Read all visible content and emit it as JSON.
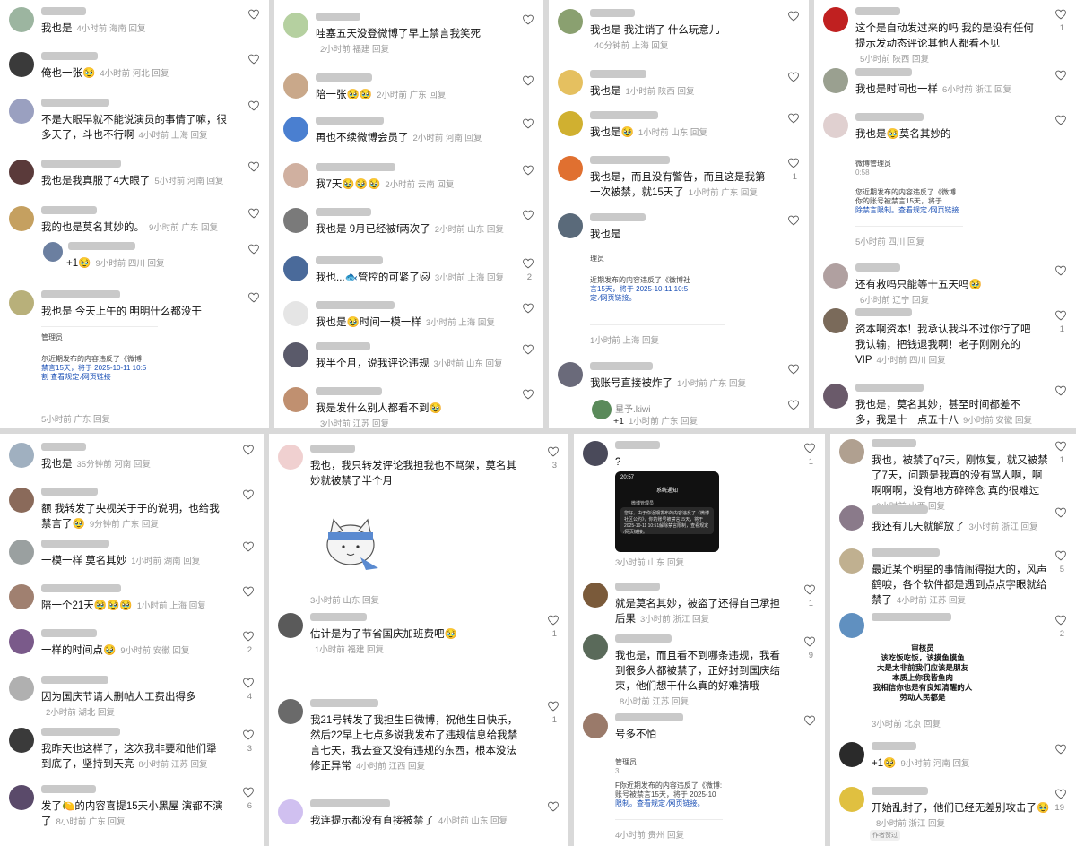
{
  "p1": [
    {
      "text": "我也是",
      "meta": "4小时前 海南 回复",
      "av": "#9cb5a0"
    },
    {
      "text": "俺也一张🥹",
      "meta": "4小时前 河北 回复",
      "av": "#3a3a3a"
    },
    {
      "text": "不是大眼早就不能说演员的事情了嘛，很多天了，斗也不行啊",
      "meta": "4小时前 上海 回复",
      "av": "#9aa0c0"
    },
    {
      "text": "我也是我真服了4大眼了",
      "meta": "5小时前 河南 回复",
      "av": "#5a3a3a"
    },
    {
      "text": "我的也是莫名其妙的。",
      "meta": "9小时前 广东 回复",
      "av": "#c5a060"
    },
    {
      "text": "+1🥹",
      "meta": "9小时前 四川 回复",
      "av": "#6b7fa0",
      "reply": true
    },
    {
      "text": "我也是 今天上午的 明明什么都没干",
      "meta": "",
      "av": "#b8b07a"
    }
  ],
  "p1_card": [
    "管理员",
    "",
    "尔近期发布的内容违反了《微博",
    "禁言15天，将于 2025-10-11 10:5",
    "割 查看规定 ⁄网页链接"
  ],
  "p1_card_meta": "5小时前 广东 回复",
  "p2": [
    {
      "text": "哇塞五天没登微博了早上禁言我笑死",
      "meta": "2小时前 福建 回复",
      "av": "#b5d0a0"
    },
    {
      "text": "陪一张🥹🥹",
      "meta": "2小时前 广东 回复",
      "av": "#c9a88a"
    },
    {
      "text": "再也不续微博会员了",
      "meta": "2小时前 河南 回复",
      "av": "#4a7fd0"
    },
    {
      "text": "我7天🥹🥹🥹",
      "meta": "2小时前 云南 回复",
      "av": "#d0b0a0"
    },
    {
      "text": "我也是 9月已经被f两次了",
      "meta": "2小时前 山东 回复",
      "av": "#7a7a7a"
    },
    {
      "text": "我也...🐟管控的可紧了🐱",
      "meta": "3小时前 上海 回复",
      "av": "#4a6a9a",
      "cnt": "2"
    },
    {
      "text": "我也是🥹时间一模一样",
      "meta": "3小时前 上海 回复",
      "av": "#e5e5e5"
    },
    {
      "text": "我半个月，说我评论违规",
      "meta": "3小时前 山东 回复",
      "av": "#5a5a6a"
    },
    {
      "text": "我是发什么别人都看不到🥹",
      "meta": "3小时前 江苏 回复",
      "av": "#c09070"
    }
  ],
  "p3": [
    {
      "text": "我也是 我注销了 什么玩意儿",
      "meta": "40分钟前 上海 回复",
      "av": "#8aa070"
    },
    {
      "text": "我也是",
      "meta": "1小时前 陕西 回复",
      "av": "#e5c060"
    },
    {
      "text": "我也是🥹",
      "meta": "1小时前 山东 回复",
      "av": "#d0b030"
    },
    {
      "text": "我也是，而且没有警告，而且这是我第一次被禁，就15天了",
      "meta": "1小时前 广东 回复",
      "av": "#e07030",
      "cnt": "1"
    },
    {
      "text": "我也是",
      "meta": "",
      "av": "#5a6a7a"
    }
  ],
  "p3_card": [
    "理员",
    "",
    "近期发布的内容违反了《微博社",
    "言15天，将于 2025-10-11 10:5",
    "定 ⁄网页链接。"
  ],
  "p3_card_meta": "1小时前 上海 回复",
  "p3_last": {
    "text": "我账号直接被炸了",
    "meta": "1小时前 广东 回复",
    "av": "#6a6a7a"
  },
  "p3_reply": {
    "name": "星予.kiwi",
    "text": "+1",
    "meta": "1小时前 广东 回复"
  },
  "p4": [
    {
      "text": "这个是自动发过来的吗 我的是没有任何提示发动态评论其他人都看不见",
      "meta": "5小时前 陕西 回复",
      "av": "#c02020",
      "cnt": "1"
    },
    {
      "text": "我也是时间也一样",
      "meta": "6小时前 浙江 回复",
      "av": "#9aa090"
    },
    {
      "text": "我也是🥹莫名其妙的",
      "meta": "",
      "av": "#e0d0d0"
    }
  ],
  "p4_card": [
    "微博管理员",
    "0:58",
    "",
    "您近期发布的内容违反了《微博",
    "你的账号被禁言15天，将于",
    "除禁言限制。查看规定 ⁄网页链接"
  ],
  "p4_card_meta": "5小时前 四川 回复",
  "p4b": [
    {
      "text": "还有救吗只能等十五天吗🥹",
      "meta": "6小时前 辽宁 回复",
      "av": "#b0a0a0"
    },
    {
      "text": "资本啊资本！我承认我斗不过你行了吧我认输，把钱退我啊！老子刚刚充的VIP",
      "meta": "4小时前 四川 回复",
      "av": "#7a6a5a",
      "cnt": "1"
    },
    {
      "text": "我也是，莫名其妙，甚至时间都差不多，我是十一点五十八",
      "meta": "9小时前 安徽 回复",
      "av": "#6a5a6a"
    }
  ],
  "p5": [
    {
      "text": "我也是",
      "meta": "35分钟前 河南 回复",
      "av": "#a0b0c0"
    },
    {
      "text": "额 我转发了央视关于于的说明，也给我禁言了🥹",
      "meta": "9分钟前 广东 回复",
      "av": "#8a6a5a"
    },
    {
      "text": "一模一样 莫名其妙",
      "meta": "1小时前 湖南 回复",
      "av": "#9aa0a0"
    },
    {
      "text": "陪一个21天🥹🥹🥹",
      "meta": "1小时前 上海 回复",
      "av": "#a08070"
    },
    {
      "text": "一样的时间点🥹",
      "meta": "9小时前 安徽 回复",
      "av": "#7a5a8a",
      "cnt": "2"
    },
    {
      "text": "因为国庆节请人删帖人工费出得多",
      "meta": "2小时前 湖北 回复",
      "av": "#b0b0b0",
      "cnt": "4"
    },
    {
      "text": "我昨天也这样了，这次我非要和他们犟到底了，坚持到天亮",
      "meta": "8小时前 江苏 回复",
      "av": "#3a3a3a",
      "cnt": "3"
    },
    {
      "text": "发了🍋的内容喜提15天小黑屋 演都不演了",
      "meta": "8小时前 广东 回复",
      "av": "#5a4a6a",
      "cnt": "6"
    }
  ],
  "p6": [
    {
      "text": "我也，我只转发评论我担我也不骂架，莫名其妙就被禁了半个月",
      "meta": "3小时前 山东 回复",
      "av": "#f0d0d0",
      "cnt": "3"
    },
    {
      "text": "估计是为了节省国庆加班费吧🥹",
      "meta": "1小时前 福建 回复",
      "av": "#5a5a5a",
      "cnt": "1"
    },
    {
      "text": "我21号转发了我担生日微博，祝他生日快乐，然后22早上七点多说我发布了违规信息给我禁言七天，我去查又没有违规的东西，根本没法修正异常",
      "meta": "4小时前 江西 回复",
      "av": "#6a6a6a",
      "cnt": "1"
    },
    {
      "text": "我连提示都没有直接被禁了",
      "meta": "4小时前 山东 回复",
      "av": "#d0c0f0"
    }
  ],
  "p7": [
    {
      "text": "?",
      "meta": "",
      "av": "#4a4a5a",
      "cnt": "1"
    }
  ],
  "p7_phone": {
    "time": "20:57",
    "title": "系统通知",
    "sender": "微博管理员",
    "body": "您好，由于你近期发布的内容违反了《微博社区公约》，你的账号被禁言15天，将于 2025-10-11 10:51解除禁言限制，查看规定 ⁄网页链接。"
  },
  "p7_phone_meta": "3小时前 山东 回复",
  "p7b": [
    {
      "text": "就是莫名其妙，被盗了还得自己承担后果",
      "meta": "3小时前 浙江 回复",
      "av": "#7a5a3a",
      "cnt": "1"
    },
    {
      "text": "我也是，而且看不到哪条违规，我看到很多人都被禁了，正好封到国庆结束，他们想干什么真的好难猜哦",
      "meta": "8小时前 江苏 回复",
      "av": "#5a6a5a",
      "cnt": "9"
    },
    {
      "text": "号多不怕",
      "meta": "",
      "av": "#9a7a6a"
    }
  ],
  "p7_card": [
    "管理员",
    "3",
    "",
    "F你近期发布的内容违反了《微博:",
    "账号被禁言15天，将于 2025-10",
    "限制。查看规定 ⁄网页链接。"
  ],
  "p7_card_meta": "4小时前 贵州 回复",
  "p8": [
    {
      "text": "我也，被禁了q7天，刚恢复，就又被禁了7天，问题是我真的没有骂人啊，啊啊啊啊，没有地方碎碎念 真的很难过",
      "meta": "3小时前 山西 回复",
      "av": "#b0a090",
      "cnt": "1"
    },
    {
      "text": "我还有几天就解放了",
      "meta": "3小时前 浙江 回复",
      "av": "#8a7a8a"
    },
    {
      "text": "最近某个明星的事情闹得挺大的，风声鹤唳，各个软件都是遇到点点字眼就给禁了",
      "meta": "4小时前 江苏 回复",
      "av": "#c0b090",
      "cnt": "5"
    },
    {
      "text": "",
      "meta": "",
      "av": "#6090c0",
      "cnt": "2"
    }
  ],
  "p8_img": [
    "审核员",
    "该吃饭吃饭，该摸鱼摸鱼",
    "大是太非前我们应该是朋友",
    "本质上你我皆鱼肉",
    "我相信你也是有良知清醒的人",
    "劳动人民都是"
  ],
  "p8_img_meta": "3小时前 北京 回复",
  "p8b": [
    {
      "text": "+1🥹",
      "meta": "9小时前 河南 回复",
      "av": "#2a2a2a"
    },
    {
      "text": "开始乱封了，他们已经无差别攻击了🥹",
      "meta": "8小时前 浙江 回复",
      "av": "#e0c040",
      "cnt": "19"
    }
  ],
  "p8_author": "作者赞过"
}
